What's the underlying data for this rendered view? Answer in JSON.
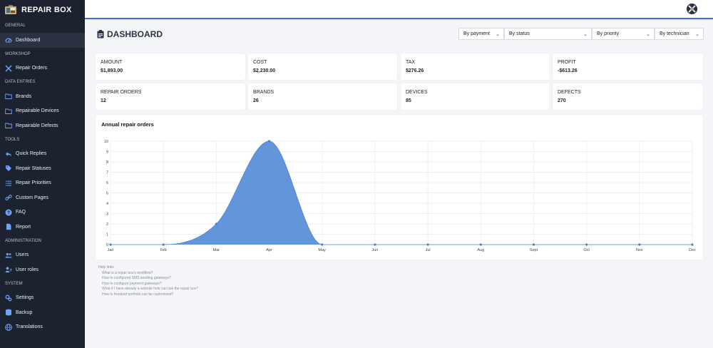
{
  "app": {
    "name": "REPAIR BOX"
  },
  "sidebar": {
    "sections": [
      {
        "title": "GENERAL",
        "items": [
          {
            "label": "Dashboard",
            "icon": "gauge-icon",
            "active": true
          }
        ]
      },
      {
        "title": "WORKSHOP",
        "items": [
          {
            "label": "Repair Orders",
            "icon": "tools-icon"
          }
        ]
      },
      {
        "title": "DATA ENTRIES",
        "items": [
          {
            "label": "Brands",
            "icon": "folder-icon"
          },
          {
            "label": "Repairable Devices",
            "icon": "folder-icon"
          },
          {
            "label": "Repairable Defects",
            "icon": "folder-icon"
          }
        ]
      },
      {
        "title": "TOOLS",
        "items": [
          {
            "label": "Quick Replies",
            "icon": "reply-icon"
          },
          {
            "label": "Repair Statuses",
            "icon": "tag-icon"
          },
          {
            "label": "Repair Priorities",
            "icon": "list-icon"
          },
          {
            "label": "Custom Pages",
            "icon": "link-icon"
          },
          {
            "label": "FAQ",
            "icon": "question-icon"
          },
          {
            "label": "Report",
            "icon": "file-icon"
          }
        ]
      },
      {
        "title": "ADMINISTRATION",
        "items": [
          {
            "label": "Users",
            "icon": "users-icon"
          },
          {
            "label": "User roles",
            "icon": "user-role-icon"
          }
        ]
      },
      {
        "title": "SYSTEM",
        "items": [
          {
            "label": "Settings",
            "icon": "gear-icon"
          },
          {
            "label": "Backup",
            "icon": "database-icon"
          },
          {
            "label": "Translations",
            "icon": "globe-icon"
          }
        ]
      }
    ]
  },
  "header": {
    "title": "DASHBOARD"
  },
  "filters": [
    "By payment",
    "By status",
    "By priority",
    "By technician"
  ],
  "stats": [
    {
      "label": "AMOUNT",
      "value": "$1,893.00"
    },
    {
      "label": "COST",
      "value": "$2,230.00"
    },
    {
      "label": "TAX",
      "value": "$276.26"
    },
    {
      "label": "PROFIT",
      "value": "-$613.26"
    },
    {
      "label": "REPAIR ORDERS",
      "value": "12"
    },
    {
      "label": "BRANDS",
      "value": "26"
    },
    {
      "label": "DEVICES",
      "value": "85"
    },
    {
      "label": "DEFECTS",
      "value": "270"
    }
  ],
  "chart": {
    "title": "Annual repair orders",
    "chart_data": {
      "type": "area",
      "title": "Annual repair orders",
      "categories": [
        "Jan",
        "Feb",
        "Mar",
        "Apr",
        "May",
        "Jun",
        "Jul",
        "Aug",
        "Sept",
        "Oct",
        "Nov",
        "Dec"
      ],
      "series": [
        {
          "values": [
            0,
            0,
            2,
            10,
            0,
            0,
            0,
            0,
            0,
            0,
            0,
            0
          ]
        }
      ],
      "ylim": [
        0,
        10
      ],
      "yticks": [
        0,
        1,
        2,
        3,
        4,
        5,
        6,
        7,
        8,
        9,
        10
      ],
      "color": "#5b8fd9",
      "grid": true
    }
  },
  "help": {
    "title": "Help links",
    "links": [
      "What is a repair box's workflow?",
      "How to configured SMS sending gateways?",
      "How to configure payment gateways?",
      "What if I have already a website how can use the repair box?",
      "How to frontend portfolio can be customized?"
    ]
  },
  "colors": {
    "sidebar": "#1c2230",
    "accent": "#3c6fd8",
    "series": "#5b8fd9"
  }
}
